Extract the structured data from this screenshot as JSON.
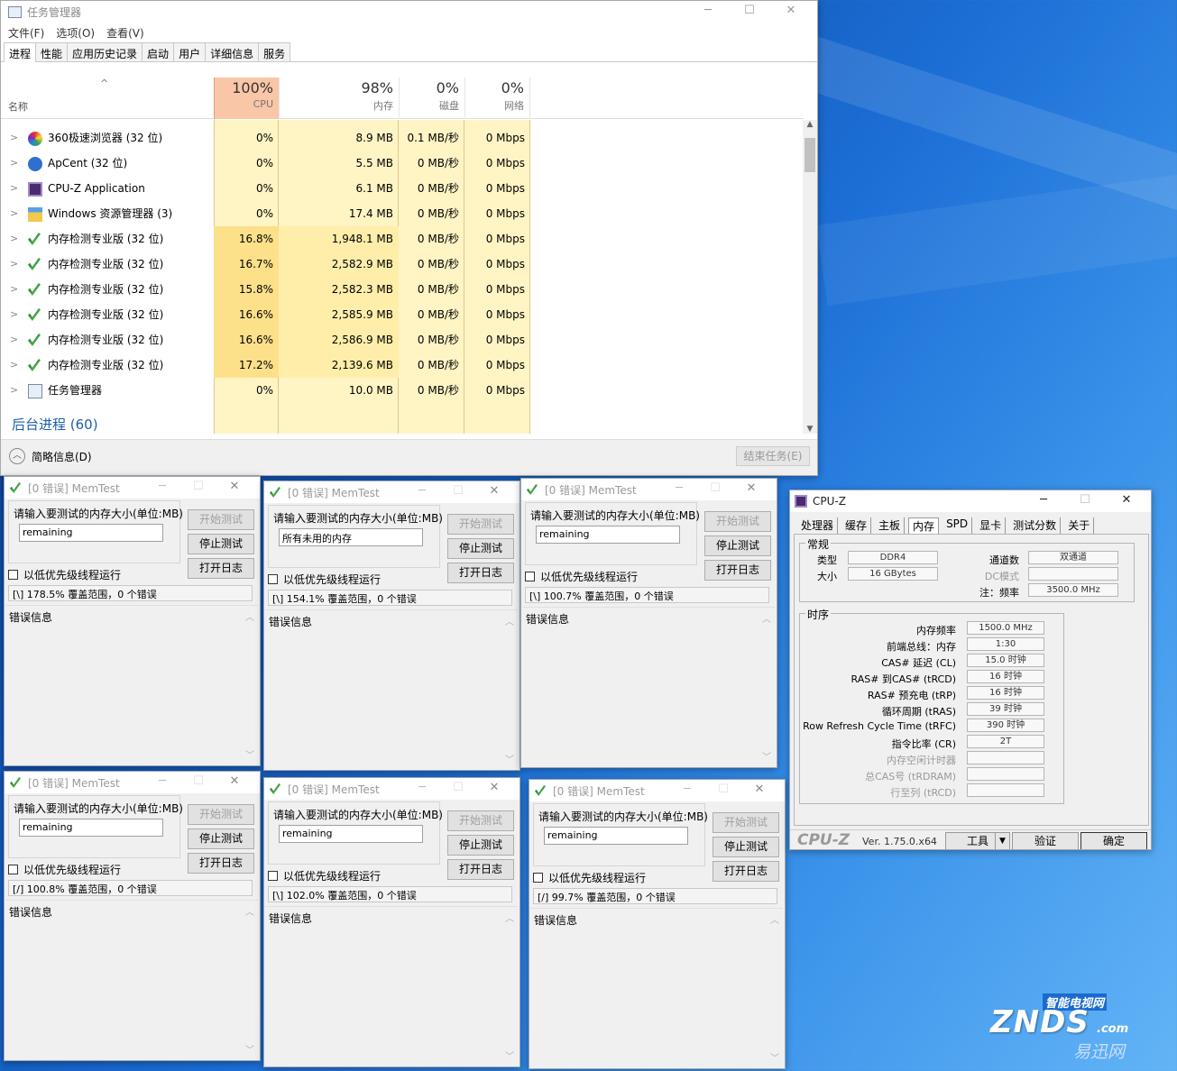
{
  "taskmgr": {
    "title": "任务管理器",
    "menu": [
      "文件(F)",
      "选项(O)",
      "查看(V)"
    ],
    "tabs": [
      "进程",
      "性能",
      "应用历史记录",
      "启动",
      "用户",
      "详细信息",
      "服务"
    ],
    "col_name": "名称",
    "cols": [
      {
        "pct": "100%",
        "label": "CPU"
      },
      {
        "pct": "98%",
        "label": "内存"
      },
      {
        "pct": "0%",
        "label": "磁盘"
      },
      {
        "pct": "0%",
        "label": "网络"
      }
    ],
    "processes": [
      {
        "name": "360极速浏览器 (32 位)",
        "icon": "360-browser-icon",
        "cpu": "0%",
        "mem": "8.9 MB",
        "disk": "0.1 MB/秒",
        "net": "0 Mbps"
      },
      {
        "name": "ApCent (32 位)",
        "icon": "apcent-icon",
        "cpu": "0%",
        "mem": "5.5 MB",
        "disk": "0 MB/秒",
        "net": "0 Mbps"
      },
      {
        "name": "CPU-Z Application",
        "icon": "cpuz-icon",
        "cpu": "0%",
        "mem": "6.1 MB",
        "disk": "0 MB/秒",
        "net": "0 Mbps"
      },
      {
        "name": "Windows 资源管理器 (3)",
        "icon": "explorer-icon",
        "cpu": "0%",
        "mem": "17.4 MB",
        "disk": "0 MB/秒",
        "net": "0 Mbps"
      },
      {
        "name": "内存检测专业版 (32 位)",
        "icon": "memtest-icon",
        "cpu": "16.8%",
        "mem": "1,948.1 MB",
        "disk": "0 MB/秒",
        "net": "0 Mbps"
      },
      {
        "name": "内存检测专业版 (32 位)",
        "icon": "memtest-icon",
        "cpu": "16.7%",
        "mem": "2,582.9 MB",
        "disk": "0 MB/秒",
        "net": "0 Mbps"
      },
      {
        "name": "内存检测专业版 (32 位)",
        "icon": "memtest-icon",
        "cpu": "15.8%",
        "mem": "2,582.3 MB",
        "disk": "0 MB/秒",
        "net": "0 Mbps"
      },
      {
        "name": "内存检测专业版 (32 位)",
        "icon": "memtest-icon",
        "cpu": "16.6%",
        "mem": "2,585.9 MB",
        "disk": "0 MB/秒",
        "net": "0 Mbps"
      },
      {
        "name": "内存检测专业版 (32 位)",
        "icon": "memtest-icon",
        "cpu": "16.6%",
        "mem": "2,586.9 MB",
        "disk": "0 MB/秒",
        "net": "0 Mbps"
      },
      {
        "name": "内存检测专业版 (32 位)",
        "icon": "memtest-icon",
        "cpu": "17.2%",
        "mem": "2,139.6 MB",
        "disk": "0 MB/秒",
        "net": "0 Mbps"
      },
      {
        "name": "任务管理器",
        "icon": "taskmgr-icon",
        "cpu": "0%",
        "mem": "10.0 MB",
        "disk": "0 MB/秒",
        "net": "0 Mbps"
      }
    ],
    "background_group": "后台进程 (60)",
    "fewer_details": "简略信息(D)",
    "end_task": "结束任务(E)"
  },
  "memtest": {
    "title": "[0 错误] MemTest",
    "prompt": "请输入要测试的内存大小(单位:MB)",
    "start": "开始测试",
    "stop": "停止测试",
    "log": "打开日志",
    "low_priority": "以低优先级线程运行",
    "error_info": "错误信息",
    "windows": [
      {
        "input": "remaining",
        "status": "[\\]   178.5% 覆盖范围，0 个错误"
      },
      {
        "input": "所有未用的内存",
        "status": "[\\]   154.1% 覆盖范围，0 个错误"
      },
      {
        "input": "remaining",
        "status": "[\\]   100.7% 覆盖范围，0 个错误"
      },
      {
        "input": "remaining",
        "status": "[/]   100.8% 覆盖范围，0 个错误"
      },
      {
        "input": "remaining",
        "status": "[\\]   102.0% 覆盖范围，0 个错误"
      },
      {
        "input": "remaining",
        "status": "[/]   99.7% 覆盖范围，0 个错误"
      }
    ]
  },
  "cpuz": {
    "title": "CPU-Z",
    "tabs": [
      "处理器",
      "缓存",
      "主板",
      "内存",
      "SPD",
      "显卡",
      "测试分数",
      "关于"
    ],
    "general": "常规",
    "type_label": "类型",
    "type_value": "DDR4",
    "size_label": "大小",
    "size_value": "16 GBytes",
    "channels_label": "通道数",
    "channels_value": "双通道",
    "dc_label": "DC模式",
    "note_label": "注：频率",
    "note_value": "3500.0 MHz",
    "timings": "时序",
    "timing_rows": [
      {
        "label": "内存频率",
        "value": "1500.0 MHz",
        "dim": false
      },
      {
        "label": "前端总线：内存",
        "value": "1:30",
        "dim": false
      },
      {
        "label": "CAS# 延迟 (CL)",
        "value": "15.0 时钟",
        "dim": false
      },
      {
        "label": "RAS# 到CAS# (tRCD)",
        "value": "16 时钟",
        "dim": false
      },
      {
        "label": "RAS# 预充电 (tRP)",
        "value": "16 时钟",
        "dim": false
      },
      {
        "label": "循环周期 (tRAS)",
        "value": "39 时钟",
        "dim": false
      },
      {
        "label": "Row Refresh Cycle Time (tRFC)",
        "value": "390 时钟",
        "dim": false
      },
      {
        "label": "指令比率 (CR)",
        "value": "2T",
        "dim": false
      },
      {
        "label": "内存空闲计时器",
        "value": "",
        "dim": true
      },
      {
        "label": "总CAS号 (tRDRAM)",
        "value": "",
        "dim": true
      },
      {
        "label": "行至列 (tRCD)",
        "value": "",
        "dim": true
      }
    ],
    "brand": "CPU-Z",
    "version": "Ver. 1.75.0.x64",
    "tools": "工具",
    "validate": "验证",
    "ok": "确定"
  },
  "watermark": {
    "top": "智能电视网",
    "main": "ZNDS",
    "suffix": ".com",
    "bottom": "易迅网"
  }
}
